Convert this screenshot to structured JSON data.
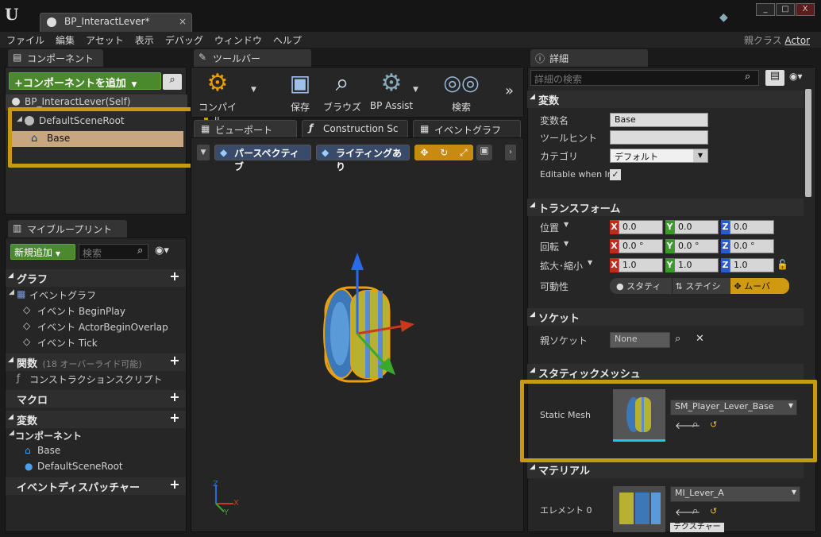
{
  "window": {
    "tab_title": "BP_InteractLever*",
    "min": "_",
    "max": "□",
    "close": "X"
  },
  "menu": [
    "ファイル",
    "編集",
    "アセット",
    "表示",
    "デバッグ",
    "ウィンドウ",
    "ヘルプ"
  ],
  "parent_class": {
    "label": "親クラス",
    "value": "Actor"
  },
  "components": {
    "tab": "コンポーネント",
    "add_button": "+コンポーネントを追加",
    "self_item": "BP_InteractLever(Self)",
    "tree": [
      {
        "label": "DefaultSceneRoot"
      },
      {
        "label": "Base"
      }
    ]
  },
  "toolbar": {
    "tab": "ツールバー",
    "buttons": [
      {
        "label": "コンパイル"
      },
      {
        "label": "保存"
      },
      {
        "label": "ブラウズ"
      },
      {
        "label": "BP Assist"
      },
      {
        "label": "検索"
      }
    ]
  },
  "editor_tabs": [
    "ビューポート",
    "Construction Sc",
    "イベントグラフ"
  ],
  "viewport": {
    "perspective": "パースペクティブ",
    "lighting": "ライティングあり"
  },
  "my_blueprint": {
    "tab": "マイブループリント",
    "add_new": "新規追加",
    "search_placeholder": "検索",
    "graph": "グラフ",
    "event_graph": "イベントグラフ",
    "events": [
      "イベント BeginPlay",
      "イベント ActorBeginOverlap",
      "イベント Tick"
    ],
    "functions": "関数",
    "functions_hint": "(18 オーバーライド可能)",
    "construction_script": "コンストラクションスクリプト",
    "macros": "マクロ",
    "variables": "変数",
    "components_head": "コンポーネント",
    "components_list": [
      "Base",
      "DefaultSceneRoot"
    ],
    "dispatchers": "イベントディスパッチャー"
  },
  "details": {
    "tab": "詳細",
    "search_placeholder": "詳細の検索",
    "variable": {
      "head": "変数",
      "name_label": "変数名",
      "name_value": "Base",
      "tooltip_label": "ツールヒント",
      "tooltip_value": "",
      "category_label": "カテゴリ",
      "category_value": "デフォルト",
      "editable_label": "Editable when Inl"
    },
    "transform": {
      "head": "トランスフォーム",
      "location_label": "位置",
      "location": [
        "0.0",
        "0.0",
        "0.0"
      ],
      "rotation_label": "回転",
      "rotation": [
        "0.0 °",
        "0.0 °",
        "0.0 °"
      ],
      "scale_label": "拡大･縮小",
      "scale": [
        "1.0",
        "1.0",
        "1.0"
      ],
      "mobility_label": "可動性",
      "mobility": [
        "スタティ",
        "ステイシ",
        "ムーバ"
      ]
    },
    "socket": {
      "head": "ソケット",
      "parent_label": "親ソケット",
      "parent_value": "None"
    },
    "static_mesh": {
      "head": "スタティックメッシュ",
      "label": "Static Mesh",
      "value": "SM_Player_Lever_Base"
    },
    "material": {
      "head": "マテリアル",
      "element_label": "エレメント 0",
      "value": "MI_Lever_A",
      "texture_btn": "テクスチャー"
    }
  },
  "axis_labels": [
    "X",
    "Y",
    "Z"
  ],
  "colors": {
    "accent_green": "#4b8a2c",
    "highlight": "#c89a12",
    "selection": "#c8a680"
  }
}
